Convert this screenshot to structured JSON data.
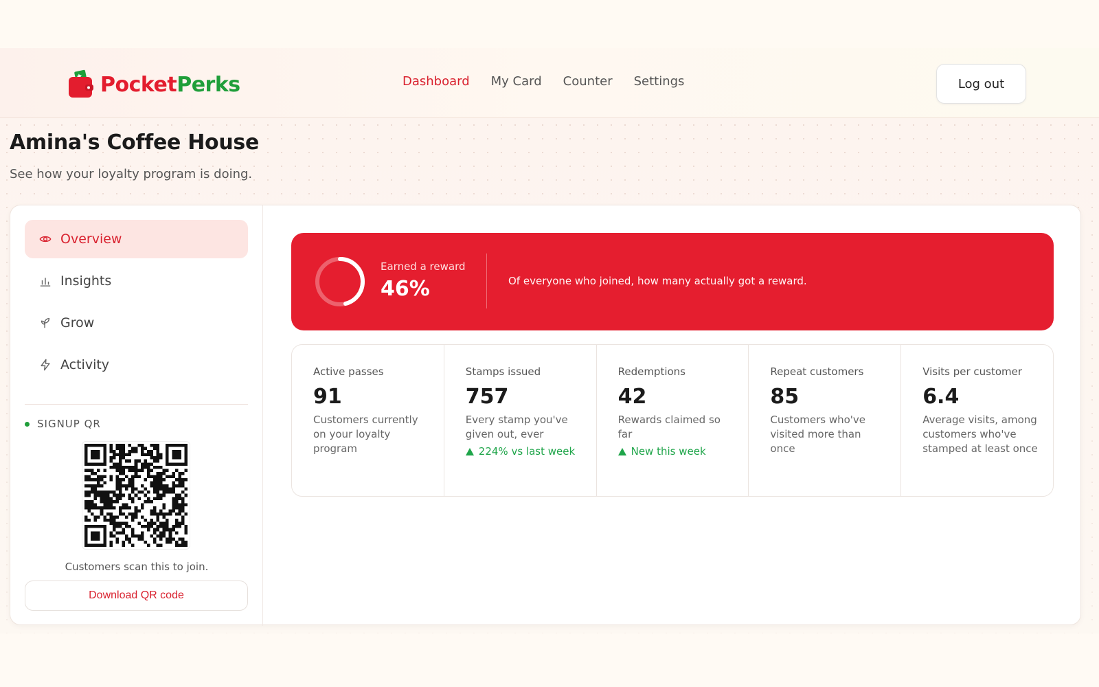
{
  "brand": {
    "name_part1": "Pocket",
    "name_part2": "Perks"
  },
  "nav": {
    "items": [
      {
        "label": "Dashboard",
        "active": true
      },
      {
        "label": "My Card",
        "active": false
      },
      {
        "label": "Counter",
        "active": false
      },
      {
        "label": "Settings",
        "active": false
      }
    ],
    "logout_label": "Log out"
  },
  "page": {
    "title": "Amina's Coffee House",
    "subtitle": "See how your loyalty program is doing."
  },
  "sidebar": {
    "items": [
      {
        "label": "Overview",
        "icon": "eye-icon",
        "active": true
      },
      {
        "label": "Insights",
        "icon": "bar-chart-icon",
        "active": false
      },
      {
        "label": "Grow",
        "icon": "sprout-icon",
        "active": false
      },
      {
        "label": "Activity",
        "icon": "lightning-icon",
        "active": false
      }
    ],
    "qr_section_label": "SIGNUP QR",
    "qr_caption": "Customers scan this to join.",
    "download_label": "Download QR code"
  },
  "reward_banner": {
    "label": "Earned a reward",
    "value": "46%",
    "fraction": 0.46,
    "description": "Of everyone who joined, how many actually got a reward."
  },
  "stats": [
    {
      "label": "Active passes",
      "value": "91",
      "description": "Customers currently on your loyalty program",
      "trend": ""
    },
    {
      "label": "Stamps issued",
      "value": "757",
      "description": "Every stamp you've given out, ever",
      "trend": "224% vs last week"
    },
    {
      "label": "Redemptions",
      "value": "42",
      "description": "Rewards claimed so far",
      "trend": "New this week"
    },
    {
      "label": "Repeat customers",
      "value": "85",
      "description": "Customers who've visited more than once",
      "trend": ""
    },
    {
      "label": "Visits per customer",
      "value": "6.4",
      "description": "Average visits, among customers who've stamped at least once",
      "trend": ""
    }
  ],
  "colors": {
    "accent": "#e51e2f",
    "brand_red": "#e31d2e",
    "brand_green": "#1f9e3a",
    "trend_green": "#1fa54a"
  }
}
